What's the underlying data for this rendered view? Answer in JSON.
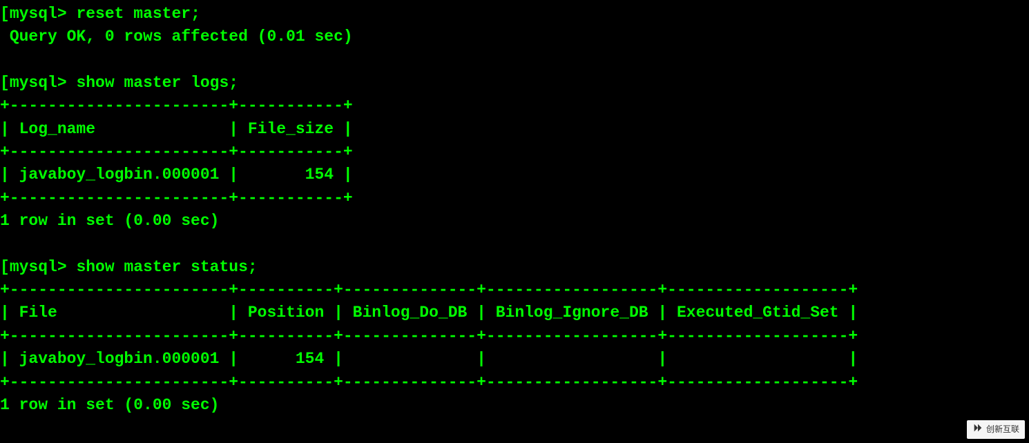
{
  "prompt": "mysql>",
  "bracket": "[",
  "commands": {
    "reset": "reset master;",
    "logs": "show master logs;",
    "status": "show master status;"
  },
  "responses": {
    "reset_ok": "Query OK, 0 rows affected (0.01 sec)",
    "logs_header_sep": "+-----------------------+-----------+",
    "logs_header": "| Log_name              | File_size |",
    "logs_row": "| javaboy_logbin.000001 |       154 |",
    "logs_footer": "1 row in set (0.00 sec)",
    "status_header_sep": "+-----------------------+----------+--------------+------------------+-------------------+",
    "status_header": "| File                  | Position | Binlog_Do_DB | Binlog_Ignore_DB | Executed_Gtid_Set |",
    "status_row": "| javaboy_logbin.000001 |      154 |              |                  |                   |",
    "status_footer": "1 row in set (0.00 sec)"
  },
  "chart_data": {
    "type": "table",
    "tables": [
      {
        "title": "show master logs",
        "columns": [
          "Log_name",
          "File_size"
        ],
        "rows": [
          [
            "javaboy_logbin.000001",
            154
          ]
        ]
      },
      {
        "title": "show master status",
        "columns": [
          "File",
          "Position",
          "Binlog_Do_DB",
          "Binlog_Ignore_DB",
          "Executed_Gtid_Set"
        ],
        "rows": [
          [
            "javaboy_logbin.000001",
            154,
            "",
            "",
            ""
          ]
        ]
      }
    ]
  },
  "watermark": "创新互联"
}
